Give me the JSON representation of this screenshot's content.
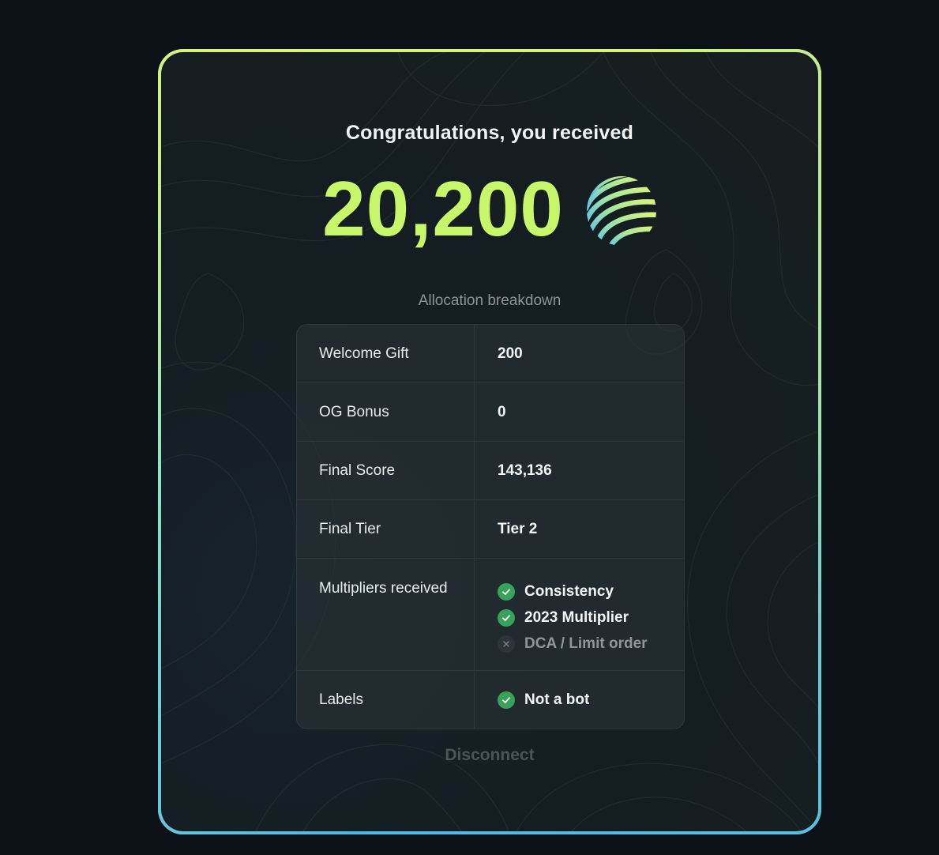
{
  "title": "Congratulations, you received",
  "amount": "20,200",
  "logo_icon": "striped-sphere-logo-icon",
  "subtitle": "Allocation breakdown",
  "breakdown": {
    "welcome_gift": {
      "label": "Welcome Gift",
      "value": "200"
    },
    "og_bonus": {
      "label": "OG Bonus",
      "value": "0"
    },
    "final_score": {
      "label": "Final Score",
      "value": "143,136"
    },
    "final_tier": {
      "label": "Final Tier",
      "value": "Tier 2"
    },
    "multipliers": {
      "label": "Multipliers received",
      "items": [
        {
          "label": "Consistency",
          "status": "received",
          "icon": "check-icon"
        },
        {
          "label": "2023 Multiplier",
          "status": "received",
          "icon": "check-icon"
        },
        {
          "label": "DCA / Limit order",
          "status": "not-received",
          "icon": "x-icon"
        }
      ]
    },
    "labels": {
      "label": "Labels",
      "items": [
        {
          "label": "Not a bot",
          "status": "received",
          "icon": "check-icon"
        }
      ]
    }
  },
  "disconnect_label": "Disconnect",
  "colors": {
    "accent": "#c8f66a",
    "check": "#37a35a",
    "background": "#0c1117",
    "border_gradient": [
      "#4fb9e6",
      "#c9f27a"
    ]
  }
}
